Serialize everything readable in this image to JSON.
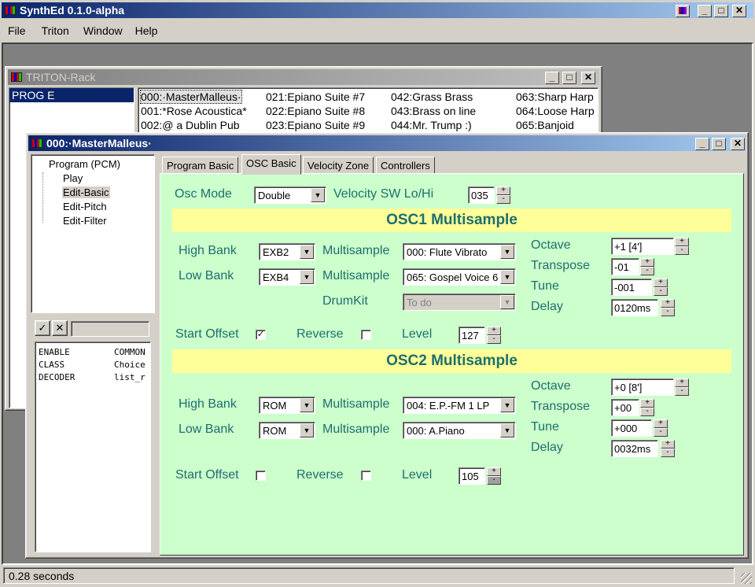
{
  "app": {
    "title": "SynthEd 0.1.0-alpha",
    "menu": [
      "File",
      "Triton",
      "Window",
      "Help"
    ]
  },
  "rack": {
    "title": "TRITON-Rack",
    "bank": "PROG E",
    "programs": [
      [
        "000:·MasterMalleus·",
        "021:Epiano Suite #7",
        "042:Grass Brass",
        "063:Sharp Harp"
      ],
      [
        "001:*Rose Acoustica*",
        "022:Epiano Suite #8",
        "043:Brass on line",
        "064:Loose Harp"
      ],
      [
        "002:@ a Dublin Pub",
        "023:Epiano Suite #9",
        "044:Mr. Trump :)",
        "065:Banjoid"
      ]
    ]
  },
  "editor": {
    "title": "000:·MasterMalleus·",
    "tree": {
      "root": "Program (PCM)",
      "items": [
        "Play",
        "Edit-Basic",
        "Edit-Pitch",
        "Edit-Filter"
      ]
    },
    "props": [
      [
        "ENABLE",
        "COMMON"
      ],
      [
        "CLASS",
        "Choice"
      ],
      [
        "DECODER",
        "list_r"
      ]
    ],
    "tabs": [
      "Program Basic",
      "OSC Basic",
      "Velocity Zone",
      "Controllers"
    ],
    "osc_mode": {
      "label": "Osc Mode",
      "value": "Double"
    },
    "vel_sw": {
      "label": "Velocity SW Lo/Hi",
      "value": "035"
    },
    "osc1": {
      "header": "OSC1 Multisample",
      "high_bank_label": "High Bank",
      "high_bank": "EXB2",
      "low_bank_label": "Low Bank",
      "low_bank": "EXB4",
      "ms_label": "Multisample",
      "ms_high": "000: Flute Vibrato",
      "ms_low": "065: Gospel Voice 6",
      "drumkit_label": "DrumKit",
      "drumkit": "To do",
      "octave_label": "Octave",
      "octave": "+1 [4']",
      "transpose_label": "Transpose",
      "transpose": "-01",
      "tune_label": "Tune",
      "tune": "-001",
      "delay_label": "Delay",
      "delay": "0120ms",
      "start_offset_label": "Start Offset",
      "start_offset": true,
      "reverse_label": "Reverse",
      "reverse": false,
      "level_label": "Level",
      "level": "127"
    },
    "osc2": {
      "header": "OSC2 Multisample",
      "high_bank_label": "High Bank",
      "high_bank": "ROM",
      "low_bank_label": "Low Bank",
      "low_bank": "ROM",
      "ms_label": "Multisample",
      "ms_high": "004: E.P.-FM 1 LP",
      "ms_low": "000: A.Piano",
      "octave_label": "Octave",
      "octave": "+0 [8']",
      "transpose_label": "Transpose",
      "transpose": "+00",
      "tune_label": "Tune",
      "tune": "+000",
      "delay_label": "Delay",
      "delay": "0032ms",
      "start_offset_label": "Start Offset",
      "start_offset": false,
      "reverse_label": "Reverse",
      "reverse": false,
      "level_label": "Level",
      "level": "105"
    }
  },
  "status": {
    "text": "0.28 seconds"
  }
}
